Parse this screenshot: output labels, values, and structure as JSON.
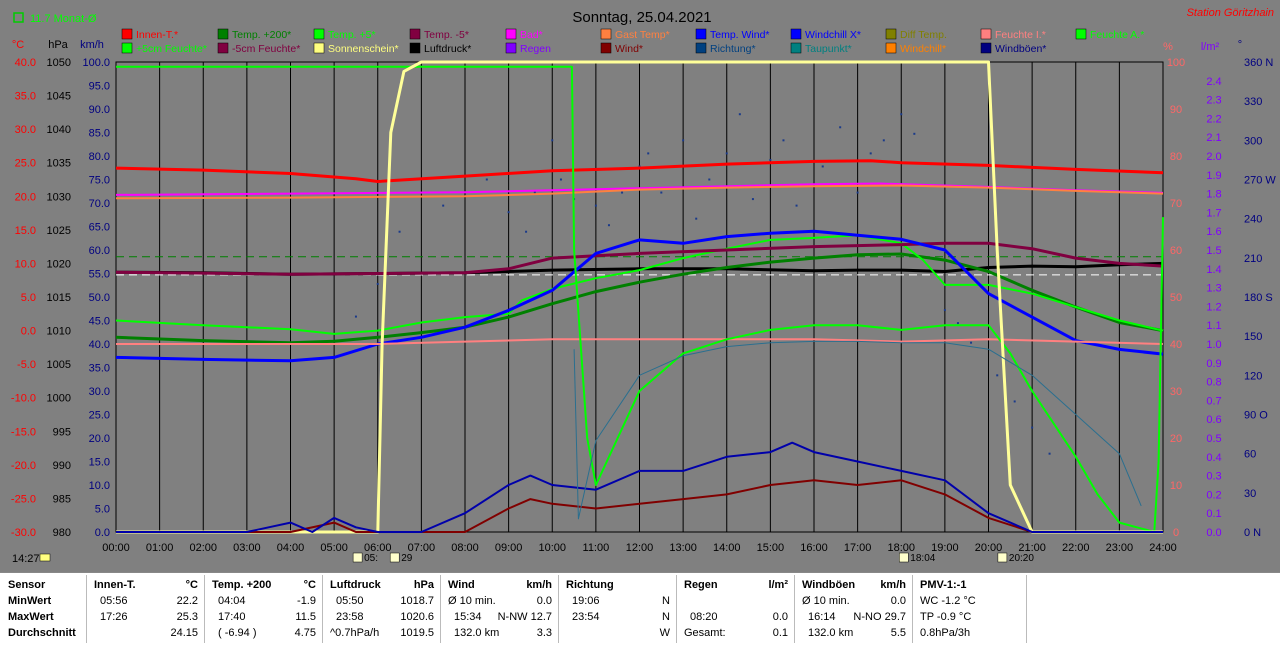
{
  "header": {
    "title": "Sonntag, 25.04.2021",
    "station": "Station Göritzhain",
    "month_avg": "11.7 Monat-Ø",
    "clock": "14:27"
  },
  "chart_data": {
    "type": "line",
    "title": "Sonntag, 25.04.2021",
    "x_ticks": [
      "00:00",
      "01:00",
      "02:00",
      "03:00",
      "04:00",
      "05:00",
      "06:00",
      "07:00",
      "08:00",
      "09:00",
      "10:00",
      "11:00",
      "12:00",
      "13:00",
      "14:00",
      "15:00",
      "16:00",
      "17:00",
      "18:00",
      "19:00",
      "20:00",
      "21:00",
      "22:00",
      "23:00",
      "24:00"
    ],
    "axes": {
      "temp_c": {
        "unit": "°C",
        "color": "#ff0000",
        "ticks": [
          "40.0",
          "35.0",
          "30.0",
          "25.0",
          "20.0",
          "15.0",
          "10.0",
          "5.0",
          "0.0",
          "-5.0",
          "-10.0",
          "-15.0",
          "-20.0",
          "-25.0",
          "-30.0"
        ],
        "ylim": [
          -30,
          40
        ]
      },
      "pressure_hpa": {
        "unit": "hPa",
        "color": "#000000",
        "ticks": [
          "1050",
          "1045",
          "1040",
          "1035",
          "1030",
          "1025",
          "1020",
          "1015",
          "1010",
          "1005",
          "1000",
          "995",
          "990",
          "985",
          "980"
        ],
        "ylim": [
          980,
          1050
        ]
      },
      "wind_kmh": {
        "unit": "km/h",
        "color": "#000080",
        "ticks": [
          "100.0",
          "95.0",
          "90.0",
          "85.0",
          "80.0",
          "75.0",
          "70.0",
          "65.0",
          "60.0",
          "55.0",
          "50.0",
          "45.0",
          "40.0",
          "35.0",
          "30.0",
          "25.0",
          "20.0",
          "15.0",
          "10.0",
          "5.0",
          "0.0"
        ],
        "ylim": [
          0,
          100
        ]
      },
      "humidity_pct": {
        "unit": "%",
        "color": "#ff6666",
        "ticks": [
          "100",
          "90",
          "80",
          "70",
          "60",
          "50",
          "40",
          "30",
          "20",
          "10",
          "0"
        ],
        "ylim": [
          0,
          100
        ]
      },
      "rain_lm2": {
        "unit": "l/m²",
        "color": "#8000ff",
        "ticks": [
          "2.4",
          "2.3",
          "2.2",
          "2.1",
          "2.0",
          "1.9",
          "1.8",
          "1.7",
          "1.6",
          "1.5",
          "1.4",
          "1.3",
          "1.2",
          "1.1",
          "1.0",
          "0.9",
          "0.8",
          "0.7",
          "0.6",
          "0.5",
          "0.4",
          "0.3",
          "0.2",
          "0.1",
          "0.0"
        ],
        "ylim": [
          0,
          2.5
        ]
      },
      "direction": {
        "unit": "°",
        "color": "#000080",
        "ticks": [
          "360 N",
          "330",
          "300",
          "270 W",
          "240",
          "210",
          "180 S",
          "150",
          "120",
          "90 O",
          "60",
          "30",
          "0 N"
        ],
        "ylim": [
          0,
          360
        ]
      }
    },
    "legend": [
      {
        "name": "Innen-T.*",
        "color": "#ff0000"
      },
      {
        "name": "Temp. +200*",
        "color": "#008000"
      },
      {
        "name": "Temp. +5*",
        "color": "#00ff00"
      },
      {
        "name": "Temp. -5*",
        "color": "#800040"
      },
      {
        "name": "Bad*",
        "color": "#ff00ff"
      },
      {
        "name": "Gast Temp*",
        "color": "#ff8040"
      },
      {
        "name": "Temp. Wind*",
        "color": "#0000ff"
      },
      {
        "name": "Windchill X*",
        "color": "#0000ff"
      },
      {
        "name": "Diff Temp.",
        "color": "#808000"
      },
      {
        "name": "Feuchte I.*",
        "color": "#ff8080"
      },
      {
        "name": "Feuchte A.*",
        "color": "#00ff00"
      },
      {
        "name": "+5cm Feuchte*",
        "color": "#00ff00"
      },
      {
        "name": "-5cm Feuchte*",
        "color": "#800040"
      },
      {
        "name": "Sonnenschein*",
        "color": "#ffff80"
      },
      {
        "name": "Luftdruck*",
        "color": "#000000"
      },
      {
        "name": "Regen",
        "color": "#8000ff"
      },
      {
        "name": "Wind*",
        "color": "#800000"
      },
      {
        "name": "Richtung*",
        "color": "#004080"
      },
      {
        "name": "Taupunkt*",
        "color": "#008080"
      },
      {
        "name": "Windchill*",
        "color": "#ff8000"
      },
      {
        "name": "Windböen*",
        "color": "#000080"
      }
    ],
    "series": [
      {
        "name": "Innen-T.*",
        "axis": "temp_c",
        "color": "#ff0000",
        "width": 3,
        "x": [
          0,
          2,
          4,
          5.5,
          6,
          8,
          10,
          12,
          14,
          16,
          17.3,
          18,
          20,
          22,
          24
        ],
        "y": [
          24.2,
          23.9,
          23.4,
          22.6,
          22.2,
          23.0,
          23.8,
          24.2,
          24.8,
          25.2,
          25.3,
          25.0,
          24.6,
          24.0,
          23.5
        ]
      },
      {
        "name": "Bad*",
        "axis": "temp_c",
        "color": "#ff00ff",
        "width": 2,
        "x": [
          0,
          4,
          8,
          10,
          12,
          14,
          16,
          17.5,
          20,
          22,
          24
        ],
        "y": [
          20.2,
          20.4,
          20.6,
          20.9,
          21.2,
          21.5,
          21.8,
          21.9,
          21.4,
          20.9,
          20.5
        ]
      },
      {
        "name": "Gast Temp*",
        "axis": "temp_c",
        "color": "#ff8040",
        "width": 2,
        "x": [
          0,
          4,
          8,
          10,
          12,
          14,
          16,
          18,
          20,
          22,
          24
        ],
        "y": [
          19.7,
          19.8,
          20.0,
          20.4,
          21.0,
          21.3,
          21.5,
          21.6,
          21.3,
          20.8,
          20.4
        ]
      },
      {
        "name": "Luftdruck*",
        "axis": "pressure_hpa",
        "color": "#000000",
        "width": 3,
        "x": [
          0,
          2,
          4,
          6,
          8,
          10,
          12,
          14,
          16,
          17,
          18,
          19,
          20,
          21,
          22,
          23,
          24
        ],
        "y": [
          1018.7,
          1018.6,
          1018.4,
          1018.5,
          1018.6,
          1019.0,
          1019.2,
          1019.2,
          1018.9,
          1019.0,
          1019.0,
          1018.8,
          1019.4,
          1019.6,
          1019.5,
          1019.8,
          1020.0
        ]
      },
      {
        "name": "Temp. +200*",
        "axis": "temp_c",
        "color": "#008000",
        "width": 3,
        "x": [
          0,
          2,
          4,
          5,
          6,
          7,
          8,
          9,
          10,
          11,
          12,
          13,
          14,
          15,
          16,
          17,
          18,
          19,
          20,
          21,
          22,
          23,
          24
        ],
        "y": [
          -1.0,
          -1.5,
          -1.8,
          -1.6,
          -1.0,
          -0.3,
          0.5,
          2.0,
          4.0,
          5.8,
          7.2,
          8.4,
          9.4,
          10.2,
          10.8,
          11.3,
          11.4,
          10.5,
          8.8,
          6.0,
          3.5,
          1.2,
          0.0
        ]
      },
      {
        "name": "Temp. +5*",
        "axis": "temp_c",
        "color": "#00ff00",
        "width": 2,
        "x": [
          0,
          2,
          4,
          5,
          6,
          7,
          8,
          9,
          9.3,
          10,
          11,
          12,
          13,
          14,
          15,
          16,
          17,
          18,
          18.5,
          19,
          20,
          21,
          22,
          23,
          24
        ],
        "y": [
          1.5,
          0.8,
          0.2,
          -0.5,
          0.0,
          1.2,
          2.0,
          2.5,
          4.5,
          6.2,
          7.8,
          9.0,
          10.8,
          12.2,
          13.5,
          13.8,
          14.2,
          13.0,
          10.5,
          6.8,
          6.8,
          5.5,
          3.5,
          1.5,
          0.0
        ]
      },
      {
        "name": "Temp. -5*",
        "axis": "temp_c",
        "color": "#800040",
        "width": 3,
        "x": [
          0,
          4,
          8,
          9,
          10,
          12,
          14,
          16,
          18,
          19,
          20,
          21,
          22,
          23,
          24
        ],
        "y": [
          8.7,
          8.4,
          8.6,
          9.2,
          10.8,
          11.5,
          12.0,
          12.5,
          12.8,
          13.0,
          13.0,
          12.2,
          10.8,
          10.0,
          9.6
        ]
      },
      {
        "name": "Temp. Wind*",
        "axis": "temp_c",
        "color": "#0000ff",
        "width": 3,
        "x": [
          0,
          2,
          4,
          5,
          6,
          7,
          8,
          9,
          10,
          11,
          12,
          13,
          14,
          15,
          16,
          17,
          18,
          19,
          20,
          21,
          22,
          23,
          24
        ],
        "y": [
          -4.0,
          -4.3,
          -4.5,
          -4.0,
          -2.0,
          -1.0,
          0.5,
          3.0,
          6.0,
          11.5,
          13.5,
          13.0,
          14.0,
          14.5,
          14.8,
          14.2,
          13.6,
          12.0,
          5.5,
          2.0,
          -1.5,
          -2.8,
          -3.5
        ]
      },
      {
        "name": "Feuchte I.*",
        "axis": "humidity_pct",
        "color": "#ff8080",
        "width": 2,
        "x": [
          0,
          2,
          4,
          6,
          8,
          10,
          12,
          14,
          16,
          18,
          20,
          22,
          24
        ],
        "y": [
          40,
          40,
          40,
          40,
          40.5,
          41,
          41,
          41,
          41,
          40.5,
          41,
          40.5,
          40
        ]
      },
      {
        "name": "Feuchte A.*",
        "axis": "humidity_pct",
        "color": "#00ff00",
        "width": 2,
        "x": [
          0,
          10.45,
          10.5,
          10.8,
          11,
          12,
          13,
          14,
          15,
          16,
          17,
          18,
          19,
          20,
          20.5,
          21,
          22,
          22.5,
          23,
          23.8,
          23.9,
          24
        ],
        "y": [
          99,
          99,
          60,
          20,
          10,
          30,
          38,
          41,
          43,
          44,
          44,
          43,
          44,
          44,
          38,
          30,
          16,
          8,
          2,
          0,
          15,
          67
        ]
      },
      {
        "name": "Sonnenschein*",
        "axis": "humidity_pct",
        "color": "#ffff99",
        "width": 3,
        "x": [
          0,
          6.0,
          6.1,
          6.3,
          6.6,
          7,
          10,
          20,
          20.2,
          20.5,
          21,
          24
        ],
        "y": [
          0,
          0,
          40,
          85,
          98,
          100,
          100,
          100,
          60,
          10,
          0,
          0
        ]
      },
      {
        "name": "Wind*",
        "axis": "wind_kmh",
        "color": "#800000",
        "width": 2,
        "x": [
          0,
          4,
          5,
          5.5,
          6,
          8,
          9,
          9.5,
          10,
          11,
          12,
          13,
          14,
          15,
          16,
          17,
          18,
          19,
          20,
          21,
          24
        ],
        "y": [
          0,
          0,
          2,
          0,
          0,
          0,
          5,
          7,
          6,
          5,
          6,
          7,
          8,
          10,
          11,
          10,
          11,
          8,
          3,
          0,
          0
        ]
      },
      {
        "name": "Windböen*",
        "axis": "wind_kmh",
        "color": "#0000aa",
        "width": 2,
        "x": [
          0,
          3,
          3.5,
          4,
          4.5,
          5,
          5.5,
          6,
          7,
          8,
          9,
          9.5,
          10,
          11,
          12,
          13,
          14,
          15,
          15.5,
          16,
          17,
          18,
          19,
          20,
          20.5,
          21,
          24
        ],
        "y": [
          0,
          0,
          1,
          2,
          0,
          3,
          1,
          0,
          0,
          4,
          10,
          12,
          10,
          9,
          13,
          13,
          16,
          17,
          19,
          17,
          15,
          13,
          11,
          4,
          2,
          0,
          0
        ]
      },
      {
        "name": "Richtung*",
        "axis": "direction",
        "color": "#2a6f8f",
        "width": 1,
        "x": [
          10.5,
          10.6,
          11,
          12,
          13,
          14,
          15,
          16,
          17,
          18,
          19,
          20,
          21,
          22,
          23,
          23.5
        ],
        "y": [
          140,
          10,
          70,
          120,
          135,
          142,
          145,
          146,
          146,
          145,
          145,
          140,
          120,
          90,
          60,
          20
        ]
      }
    ],
    "direction_scatter": {
      "axis": "direction",
      "color": "#1a3a8a",
      "x": [
        5.5,
        6,
        6.5,
        7.5,
        8.5,
        9,
        9.4,
        9.6,
        10,
        10.2,
        10.5,
        11,
        11.3,
        11.6,
        12,
        12.2,
        12.5,
        12.8,
        13,
        13.3,
        13.6,
        14,
        14.3,
        14.6,
        15,
        15.3,
        15.6,
        16,
        16.2,
        16.6,
        17,
        17.3,
        17.6,
        18,
        18.3,
        18.6,
        19,
        19.3,
        19.6,
        20.2,
        20.6,
        21,
        21.4
      ],
      "y": [
        165,
        190,
        230,
        250,
        270,
        245,
        230,
        260,
        300,
        270,
        255,
        250,
        235,
        260,
        280,
        290,
        260,
        280,
        300,
        240,
        270,
        290,
        320,
        255,
        285,
        300,
        250,
        265,
        280,
        310,
        260,
        290,
        300,
        320,
        305,
        200,
        170,
        160,
        145,
        120,
        100,
        80,
        60
      ]
    },
    "dashed_lines": [
      {
        "axis": "temp_c",
        "color": "#008000",
        "y": 11.0
      },
      {
        "axis": "temp_c",
        "color": "#ffffff",
        "y": 8.3
      }
    ],
    "markers": [
      {
        "label": "05:",
        "time": 5.55
      },
      {
        "label": "29",
        "time": 6.4
      },
      {
        "label": "18:04",
        "time": 18.07
      },
      {
        "label": "20:20",
        "time": 20.33
      }
    ]
  },
  "stats": {
    "sensor": {
      "header": "Sensor",
      "rows": [
        "MinWert",
        "MaxWert",
        "Durchschnitt"
      ]
    },
    "innen": {
      "header": "Innen-T.",
      "unit": "°C",
      "rows": [
        [
          "05:56",
          "22.2"
        ],
        [
          "17:26",
          "25.3"
        ],
        [
          "",
          "24.15"
        ]
      ]
    },
    "temp200": {
      "header": "Temp. +200",
      "unit": "°C",
      "rows": [
        [
          "04:04",
          "-1.9"
        ],
        [
          "17:40",
          "11.5"
        ],
        [
          "( -6.94 )",
          "4.75"
        ]
      ]
    },
    "druck": {
      "header": "Luftdruck",
      "unit": "hPa",
      "rows": [
        [
          "05:50",
          "1018.7"
        ],
        [
          "23:58",
          "1020.6"
        ],
        [
          "^0.7hPa/h",
          "1019.5"
        ]
      ]
    },
    "wind": {
      "header": "Wind",
      "unit": "km/h",
      "rows": [
        [
          "Ø 10 min.",
          "",
          "0.0"
        ],
        [
          "15:34",
          "N-NW 12.7",
          ""
        ],
        [
          "132.0 km",
          "",
          "3.3"
        ]
      ]
    },
    "richtung": {
      "header": "Richtung",
      "rows": [
        [
          "19:06",
          "N"
        ],
        [
          "23:54",
          "N"
        ],
        [
          "",
          "W"
        ]
      ]
    },
    "regen": {
      "header": "Regen",
      "unit": "l/m²",
      "rows": [
        [
          "",
          ""
        ],
        [
          "08:20",
          "0.0"
        ],
        [
          "Gesamt:",
          "0.1"
        ]
      ]
    },
    "boeen": {
      "header": "Windböen",
      "unit": "km/h",
      "rows": [
        [
          "Ø 10 min.",
          "",
          "0.0"
        ],
        [
          "16:14",
          "N-NO 29.7",
          ""
        ],
        [
          "132.0 km",
          "",
          "5.5"
        ]
      ]
    },
    "pmv": {
      "header": "PMV-1:-1",
      "rows": [
        "WC -1.2 °C",
        "TP -0.9 °C",
        "0.8hPa/3h"
      ]
    }
  }
}
